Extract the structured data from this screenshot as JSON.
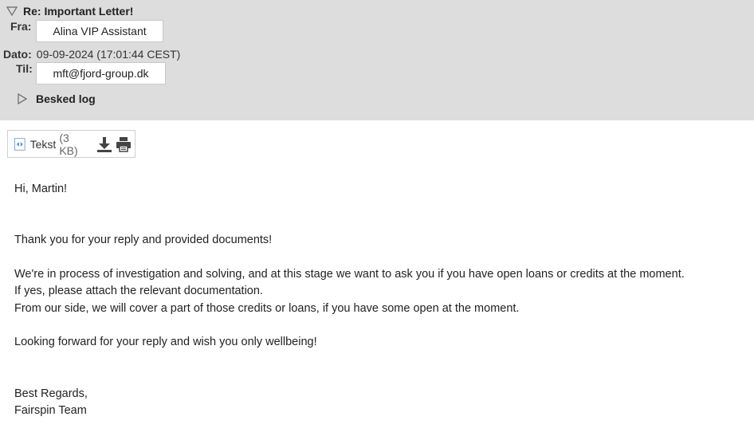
{
  "header": {
    "subject": "Re: Important Letter!",
    "from_label": "Fra:",
    "from_value": "Alina VIP Assistant",
    "date_label": "Dato:",
    "date_value": "09-09-2024 (17:01:44 CEST)",
    "to_label": "Til:",
    "to_value": "mft@fjord-group.dk",
    "log_label": "Besked log"
  },
  "attachment": {
    "name": "Tekst",
    "size": "(3 KB)",
    "icons": [
      "file-icon",
      "download-icon",
      "print-icon"
    ]
  },
  "message": {
    "greeting": "Hi, Martin!",
    "line1": "Thank you for your reply and provided documents!",
    "line2": "We're in process of investigation and solving, and at this stage we want to ask you if you have open loans or credits at the moment.",
    "line3": "If yes, please attach the relevant documentation.",
    "line4": "From our side, we will cover a part of those credits or loans, if you have some open at the moment.",
    "line5": "Looking forward for your reply and wish you only wellbeing!",
    "signoff": "Best Regards,",
    "signature": "Fairspin Team"
  },
  "colors": {
    "header_bg": "#dddddd",
    "text": "#222222"
  }
}
